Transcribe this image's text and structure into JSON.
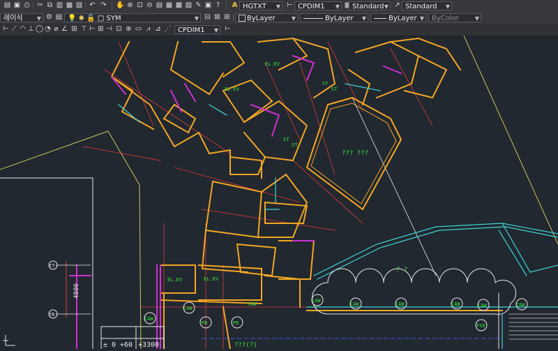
{
  "toolbar_row1": {
    "text_style": "HGTXT",
    "dim_style": "CPDIM1",
    "table_style": "Standard",
    "mleader_style": "Standard"
  },
  "toolbar_row2": {
    "workspace": "레이식",
    "layer": "SYM",
    "color": "ByLayer",
    "linetype": "ByLayer",
    "lineweight": "ByLayer",
    "plotstyle": "ByColor"
  },
  "toolbar_row3": {
    "dim_style": "CPDIM1"
  },
  "drawing": {
    "room_labels": [
      "??? ???",
      "? ?",
      "???(?)"
    ],
    "elevation_texts": [
      "± 0",
      "+60",
      "+3300"
    ],
    "dimension": "4800",
    "grid_markers": [
      "Y7",
      "Y6"
    ],
    "tags": [
      "CAW",
      "CAW",
      "CAW",
      "CAW",
      "CAW",
      "CAW",
      "CAW",
      "CAW",
      "CAW",
      "PD",
      "PD",
      "FSO"
    ],
    "elev_labels": [
      "EL.EV",
      "EL.EV",
      "EL.EV",
      "EL.EV"
    ],
    "st_labels": [
      "ST",
      "ST",
      "ST",
      "ST"
    ]
  },
  "colors": {
    "background": "#212830",
    "wall": "#f4a623",
    "red_line": "#e23a3a",
    "cyan_line": "#3fd6d6",
    "magenta": "#d030d0",
    "green_text": "#35e835",
    "white_line": "#e8e8e8",
    "yellow_line": "#c8c85a",
    "gray_line": "#9aa0a6"
  }
}
